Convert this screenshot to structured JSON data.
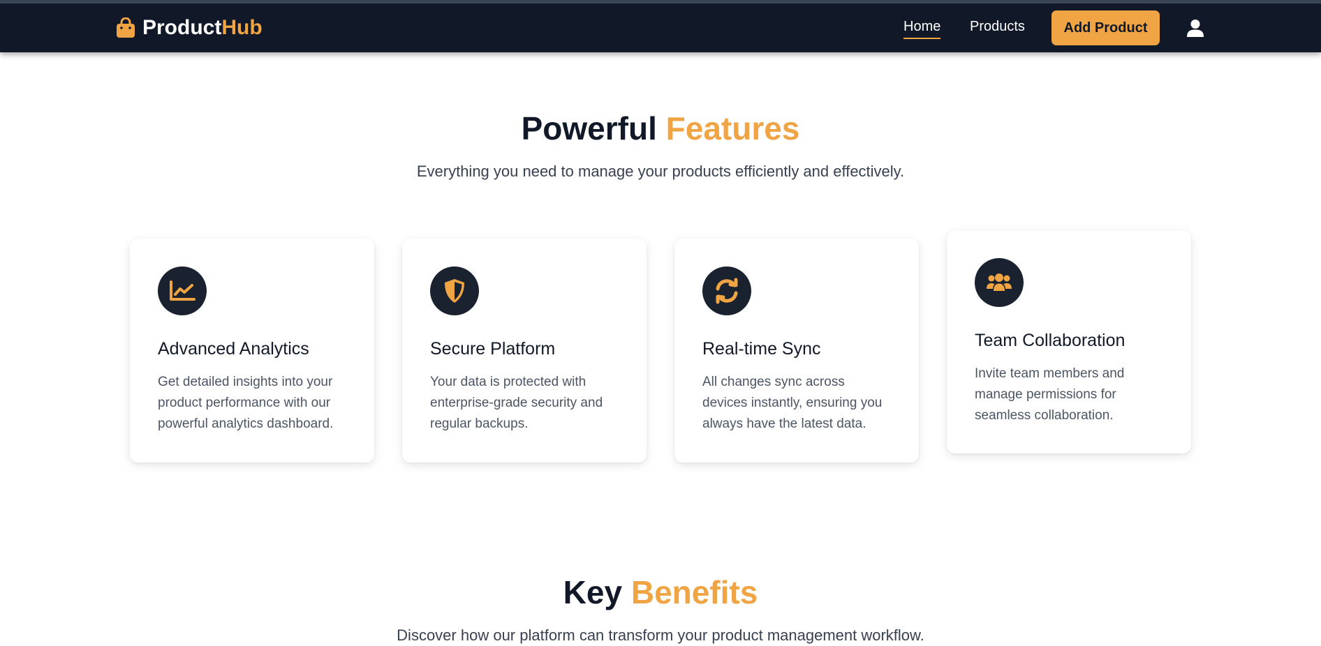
{
  "brand": {
    "name_part1": "Product",
    "name_part2": "Hub",
    "accent_color": "#f0a444",
    "icon": "shopping-bag-icon"
  },
  "nav": {
    "home_label": "Home",
    "products_label": "Products",
    "add_product_label": "Add Product",
    "user_icon": "user-icon"
  },
  "features": {
    "title_part1": "Powerful",
    "title_part2": "Features",
    "subtitle": "Everything you need to manage your products efficiently and effectively.",
    "cards": [
      {
        "icon": "chart-line-icon",
        "title": "Advanced Analytics",
        "description": "Get detailed insights into your product performance with our powerful analytics dashboard."
      },
      {
        "icon": "shield-icon",
        "title": "Secure Platform",
        "description": "Your data is protected with enterprise-grade security and regular backups."
      },
      {
        "icon": "sync-icon",
        "title": "Real-time Sync",
        "description": "All changes sync across devices instantly, ensuring you always have the latest data."
      },
      {
        "icon": "users-icon",
        "title": "Team Collaboration",
        "description": "Invite team members and manage permissions for seamless collaboration."
      }
    ]
  },
  "benefits": {
    "title_part1": "Key",
    "title_part2": "Benefits",
    "subtitle": "Discover how our platform can transform your product management workflow."
  },
  "colors": {
    "navbar": "#111827",
    "accent": "#f0a444",
    "icon_bg": "#1a2230",
    "text_dark": "#111827",
    "text_muted": "#4b5563"
  }
}
